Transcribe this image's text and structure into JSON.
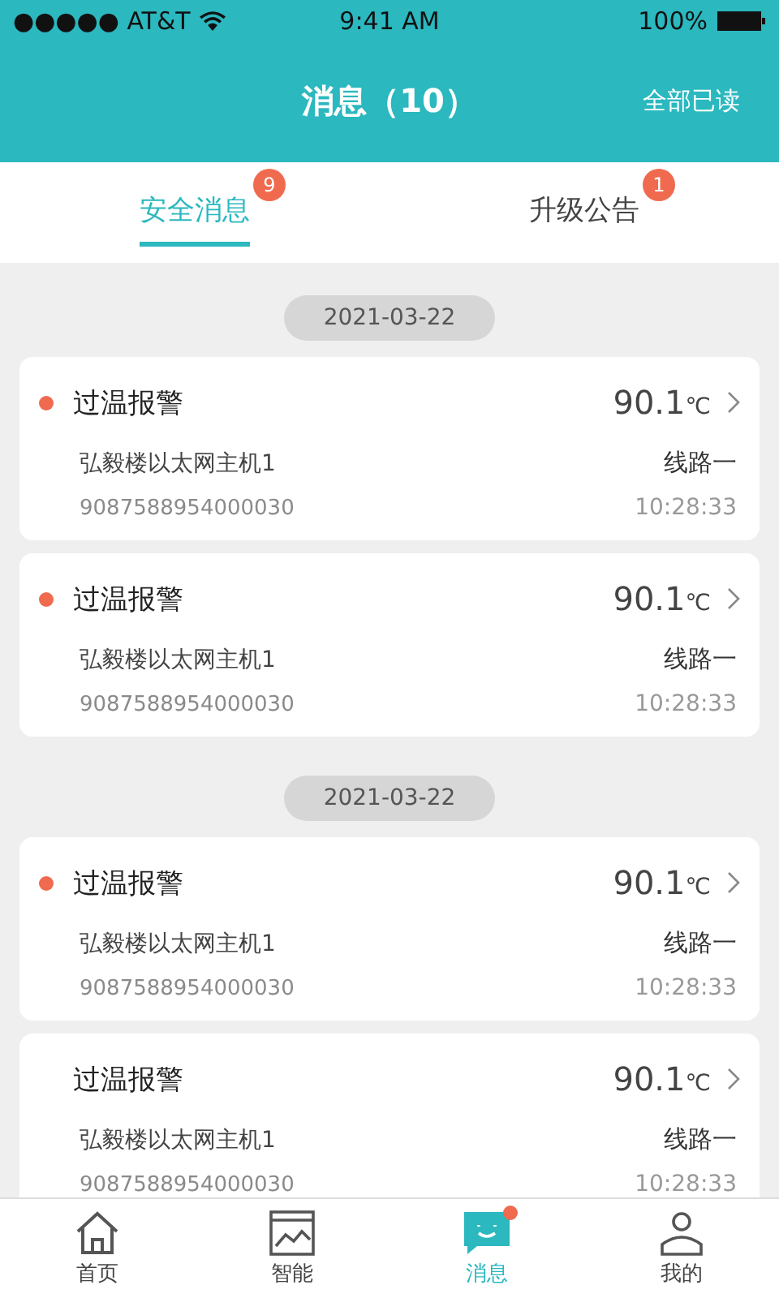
{
  "status_bar": {
    "carrier": "●●●●● AT&T",
    "time": "9:41 AM",
    "battery": "100%"
  },
  "header": {
    "title": "消息（10）",
    "action": "全部已读"
  },
  "tabs": [
    {
      "label": "安全消息",
      "badge": "9",
      "selected": true
    },
    {
      "label": "升级公告",
      "badge": "1",
      "selected": false
    }
  ],
  "groups": [
    {
      "date": "2021-03-22",
      "messages": [
        {
          "title": "过温报警",
          "unread": true,
          "value": "90.1",
          "unit": "℃",
          "device": "弘毅楼以太网主机1",
          "line": "线路一",
          "serial": "9087588954000030",
          "time": "10:28:33"
        },
        {
          "title": "过温报警",
          "unread": true,
          "value": "90.1",
          "unit": "℃",
          "device": "弘毅楼以太网主机1",
          "line": "线路一",
          "serial": "9087588954000030",
          "time": "10:28:33"
        }
      ]
    },
    {
      "date": "2021-03-22",
      "messages": [
        {
          "title": "过温报警",
          "unread": true,
          "value": "90.1",
          "unit": "℃",
          "device": "弘毅楼以太网主机1",
          "line": "线路一",
          "serial": "9087588954000030",
          "time": "10:28:33"
        },
        {
          "title": "过温报警",
          "unread": false,
          "value": "90.1",
          "unit": "℃",
          "device": "弘毅楼以太网主机1",
          "line": "线路一",
          "serial": "9087588954000030",
          "time": "10:28:33"
        }
      ]
    }
  ],
  "tab_bar": [
    {
      "kind": "home",
      "label": "首页",
      "selected": false,
      "dot": false
    },
    {
      "kind": "smart",
      "label": "智能",
      "selected": false,
      "dot": false
    },
    {
      "kind": "message",
      "label": "消息",
      "selected": true,
      "dot": true
    },
    {
      "kind": "me",
      "label": "我的",
      "selected": false,
      "dot": false
    }
  ]
}
